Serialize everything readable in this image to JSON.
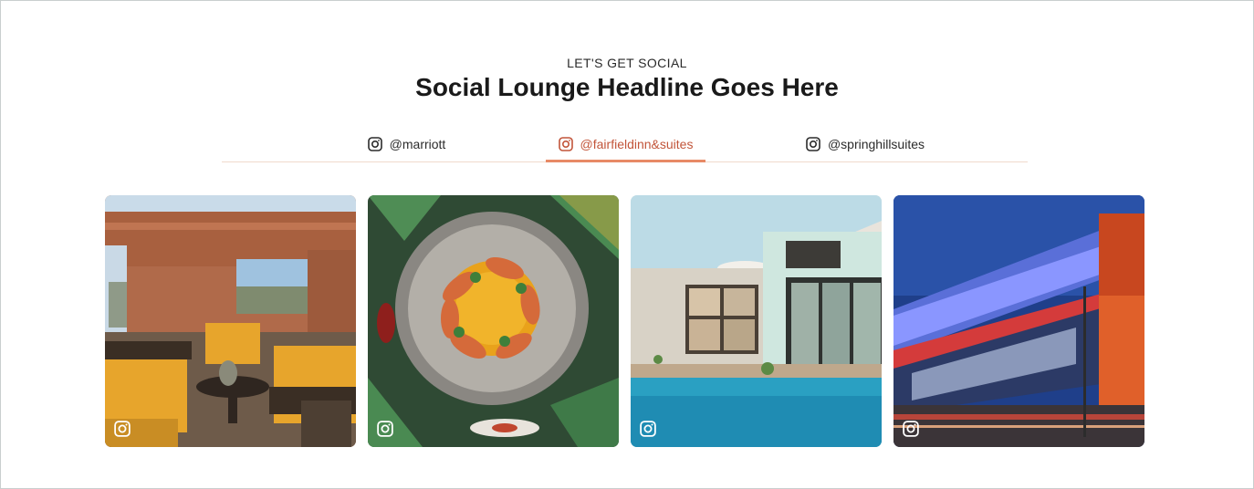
{
  "section": {
    "eyebrow": "LET'S GET SOCIAL",
    "headline": "Social Lounge Headline Goes Here"
  },
  "tabs": [
    {
      "label": "@marriott",
      "icon": "instagram-icon",
      "active": false
    },
    {
      "label": "@fairfieldinn&suites",
      "icon": "instagram-icon",
      "active": true
    },
    {
      "label": "@springhillsuites",
      "icon": "instagram-icon",
      "active": false
    }
  ],
  "colors": {
    "accent": "#e88a66",
    "accent_text": "#c2553a",
    "divider": "#f0d9cc",
    "border": "#c9cfcf"
  },
  "posts": [
    {
      "icon": "instagram-icon"
    },
    {
      "icon": "instagram-icon"
    },
    {
      "icon": "instagram-icon"
    },
    {
      "icon": "instagram-icon"
    }
  ]
}
